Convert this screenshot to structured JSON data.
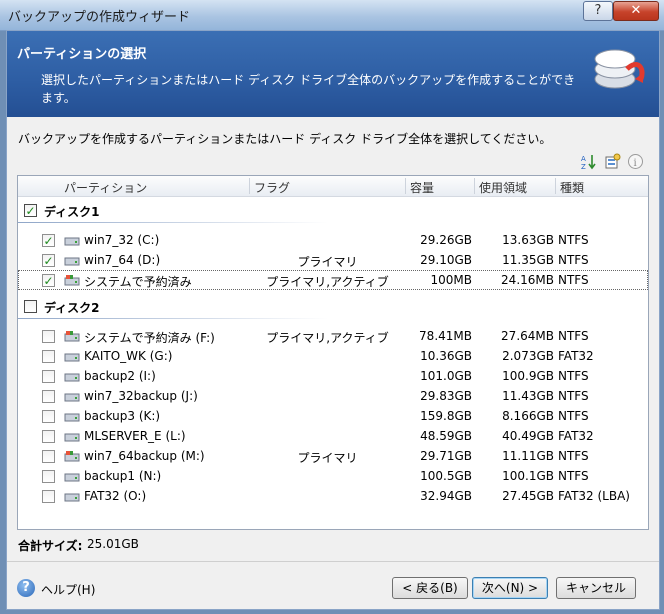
{
  "window": {
    "title": "バックアップの作成ウィザード",
    "help_glyph": "?",
    "close_glyph": "✕"
  },
  "banner": {
    "title": "パーティションの選択",
    "description": "選択したパーティションまたはハード ディスク ドライブ全体のバックアップを作成することができます。"
  },
  "instruction": "バックアップを作成するパーティションまたはハード ディスク ドライブ全体を選択してください。",
  "toolbar_icons": [
    "sort-icon",
    "properties-icon",
    "info-icon"
  ],
  "columns": {
    "partition": "パーティション",
    "flag": "フラグ",
    "capacity": "容量",
    "used": "使用領域",
    "type": "種類"
  },
  "disks": [
    {
      "name": "ディスク1",
      "checked": true,
      "partitions": [
        {
          "name": "win7_32 (C:)",
          "flag": "",
          "capacity": "29.26GB",
          "used": "13.63GB",
          "type": "NTFS",
          "checked": true,
          "icon": "disk-icon"
        },
        {
          "name": "win7_64 (D:)",
          "flag": "プライマリ",
          "capacity": "29.10GB",
          "used": "11.35GB",
          "type": "NTFS",
          "checked": true,
          "icon": "disk-icon"
        },
        {
          "name": "システムで予約済み",
          "flag": "プライマリ,アクティブ",
          "capacity": "100MB",
          "used": "24.16MB",
          "type": "NTFS",
          "checked": true,
          "icon": "system-disk-icon",
          "selected": true
        }
      ]
    },
    {
      "name": "ディスク2",
      "checked": false,
      "partitions": [
        {
          "name": "システムで予約済み (F:)",
          "flag": "プライマリ,アクティブ",
          "capacity": "78.41MB",
          "used": "27.64MB",
          "type": "NTFS",
          "checked": false,
          "icon": "system-disk-icon"
        },
        {
          "name": "KAITO_WK (G:)",
          "flag": "",
          "capacity": "10.36GB",
          "used": "2.073GB",
          "type": "FAT32",
          "checked": false,
          "icon": "disk-icon"
        },
        {
          "name": "backup2 (I:)",
          "flag": "",
          "capacity": "101.0GB",
          "used": "100.9GB",
          "type": "NTFS",
          "checked": false,
          "icon": "disk-icon"
        },
        {
          "name": "win7_32backup (J:)",
          "flag": "",
          "capacity": "29.83GB",
          "used": "11.43GB",
          "type": "NTFS",
          "checked": false,
          "icon": "disk-icon"
        },
        {
          "name": "backup3 (K:)",
          "flag": "",
          "capacity": "159.8GB",
          "used": "8.166GB",
          "type": "NTFS",
          "checked": false,
          "icon": "disk-icon"
        },
        {
          "name": "MLSERVER_E (L:)",
          "flag": "",
          "capacity": "48.59GB",
          "used": "40.49GB",
          "type": "FAT32",
          "checked": false,
          "icon": "disk-icon"
        },
        {
          "name": "win7_64backup (M:)",
          "flag": "プライマリ",
          "capacity": "29.71GB",
          "used": "11.11GB",
          "type": "NTFS",
          "checked": false,
          "icon": "system-disk-icon"
        },
        {
          "name": "backup1 (N:)",
          "flag": "",
          "capacity": "100.5GB",
          "used": "100.1GB",
          "type": "NTFS",
          "checked": false,
          "icon": "disk-icon"
        },
        {
          "name": "FAT32 (O:)",
          "flag": "",
          "capacity": "32.94GB",
          "used": "27.45GB",
          "type": "FAT32 (LBA)",
          "checked": false,
          "icon": "disk-icon"
        }
      ]
    }
  ],
  "total": {
    "label": "合計サイズ:",
    "value": "25.01GB"
  },
  "footer": {
    "help": "ヘルプ(H)",
    "back": "< 戻る(B)",
    "next": "次へ(N) >",
    "cancel": "キャンセル"
  },
  "colors": {
    "banner": "#2d5da3",
    "check": "#1d8a1d",
    "close": "#c7432b"
  }
}
